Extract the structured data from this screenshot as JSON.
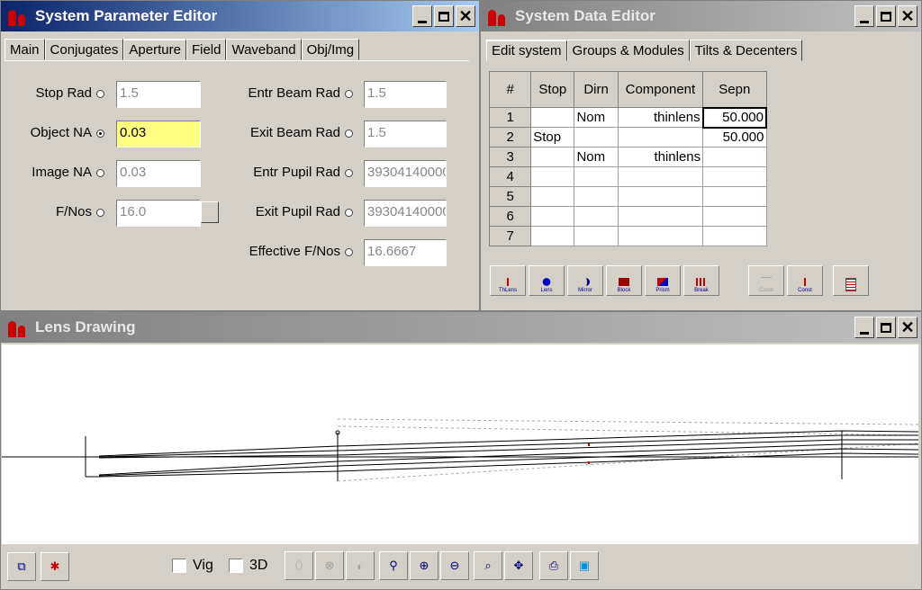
{
  "param_editor": {
    "title": "System Parameter Editor",
    "tabs": [
      "Main",
      "Conjugates",
      "Aperture",
      "Field",
      "Waveband",
      "Obj/Img"
    ],
    "selected_tab": "Aperture",
    "left_fields": [
      {
        "label": "Stop Rad",
        "value": "1.5",
        "selected": false
      },
      {
        "label": "Object NA",
        "value": "0.03",
        "selected": true
      },
      {
        "label": "Image NA",
        "value": "0.03",
        "selected": false
      },
      {
        "label": "F/Nos",
        "value": "16.0",
        "selected": false
      }
    ],
    "right_fields": [
      {
        "label": "Entr Beam Rad",
        "value": "1.5"
      },
      {
        "label": "Exit Beam Rad",
        "value": "1.5"
      },
      {
        "label": "Entr Pupil Rad",
        "value": "39304140000"
      },
      {
        "label": "Exit Pupil Rad",
        "value": "39304140000"
      },
      {
        "label": "Effective F/Nos",
        "value": "16.6667"
      }
    ]
  },
  "data_editor": {
    "title": "System Data Editor",
    "tabs": [
      "Edit system",
      "Groups & Modules",
      "Tilts & Decenters"
    ],
    "selected_tab": "Edit system",
    "columns": [
      "#",
      "Stop",
      "Dirn",
      "Component",
      "Sepn"
    ],
    "rows": [
      {
        "num": "1",
        "stop": "",
        "dirn": "Nom",
        "component": "thinlens",
        "sepn": "50.000"
      },
      {
        "num": "2",
        "stop": "Stop",
        "dirn": "",
        "component": "",
        "sepn": "50.000"
      },
      {
        "num": "3",
        "stop": "",
        "dirn": "Nom",
        "component": "thinlens",
        "sepn": ""
      },
      {
        "num": "4",
        "stop": "",
        "dirn": "",
        "component": "",
        "sepn": ""
      },
      {
        "num": "5",
        "stop": "",
        "dirn": "",
        "component": "",
        "sepn": ""
      },
      {
        "num": "6",
        "stop": "",
        "dirn": "",
        "component": "",
        "sepn": ""
      },
      {
        "num": "7",
        "stop": "",
        "dirn": "",
        "component": "",
        "sepn": ""
      }
    ],
    "toolbar": [
      {
        "label": "ThLens",
        "icon": "thin-lens-icon",
        "enabled": true
      },
      {
        "label": "Lens",
        "icon": "lens-icon",
        "enabled": true
      },
      {
        "label": "Mirror",
        "icon": "mirror-icon",
        "enabled": true
      },
      {
        "label": "Block",
        "icon": "block-icon",
        "enabled": true
      },
      {
        "label": "Prism",
        "icon": "prism-icon",
        "enabled": true
      },
      {
        "label": "Break",
        "icon": "break-icon",
        "enabled": true
      },
      {
        "label": "Const",
        "icon": "linos-const-icon",
        "enabled": false
      },
      {
        "label": "Const",
        "icon": "thorlabs-const-icon",
        "enabled": true
      },
      {
        "label": "",
        "icon": "report-icon",
        "enabled": true
      }
    ]
  },
  "lens_drawing": {
    "title": "Lens Drawing",
    "vig_label": "Vig",
    "threed_label": "3D",
    "tools": [
      {
        "icon": "select-icon",
        "enabled": true
      },
      {
        "icon": "ray-icon",
        "enabled": true
      },
      {
        "icon": "rotate-x-icon",
        "enabled": false
      },
      {
        "icon": "rotate-y-icon",
        "enabled": false
      },
      {
        "icon": "rotate-z-icon",
        "enabled": false
      },
      {
        "icon": "zoom-icon",
        "enabled": true
      },
      {
        "icon": "zoom-in-icon",
        "enabled": true
      },
      {
        "icon": "zoom-out-icon",
        "enabled": true
      },
      {
        "icon": "zoom-fit-icon",
        "enabled": true
      },
      {
        "icon": "pan-icon",
        "enabled": true
      },
      {
        "icon": "print-icon",
        "enabled": true
      },
      {
        "icon": "export-icon",
        "enabled": true
      }
    ]
  },
  "colors": {
    "active_title": "#0a246a",
    "inactive_title": "#808080",
    "highlight_field": "#ffff80",
    "ray": "#000000",
    "marker": "#cc0000"
  }
}
